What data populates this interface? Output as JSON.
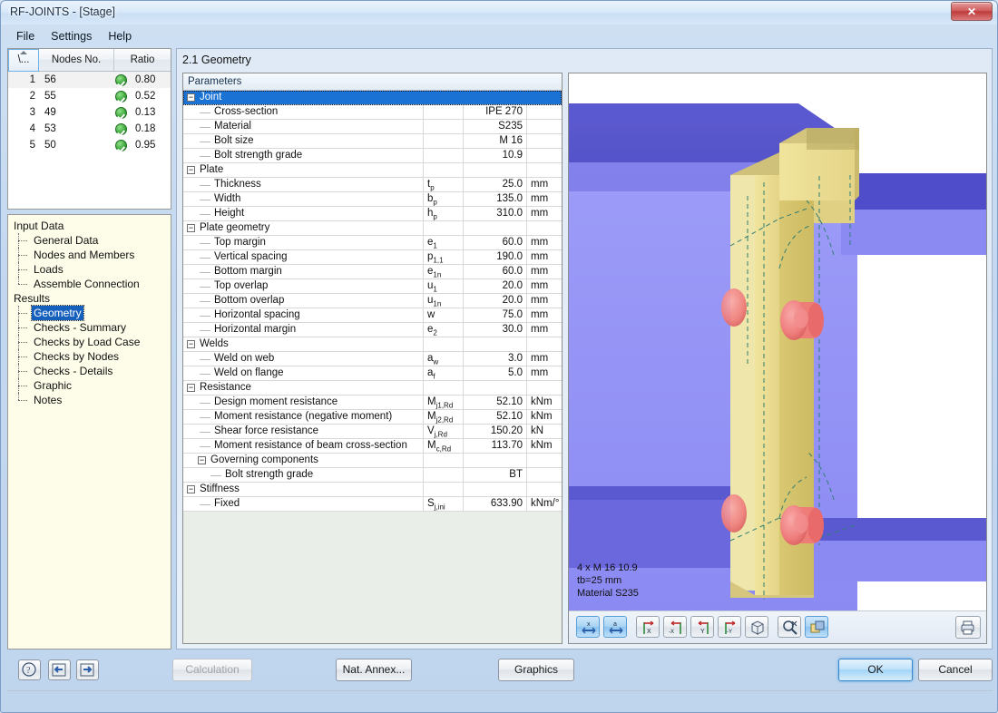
{
  "window": {
    "title": "RF-JOINTS - [Stage]",
    "close_label": "✕"
  },
  "menubar": {
    "items": [
      {
        "label": "File"
      },
      {
        "label": "Settings"
      },
      {
        "label": "Help"
      }
    ]
  },
  "node_table": {
    "headers": [
      "\\...",
      "Nodes No.",
      "Ratio"
    ],
    "rows": [
      {
        "index": "1",
        "node": "56",
        "ratio": "0.80",
        "status": "ok"
      },
      {
        "index": "2",
        "node": "55",
        "ratio": "0.52",
        "status": "ok"
      },
      {
        "index": "3",
        "node": "49",
        "ratio": "0.13",
        "status": "ok"
      },
      {
        "index": "4",
        "node": "53",
        "ratio": "0.18",
        "status": "ok"
      },
      {
        "index": "5",
        "node": "50",
        "ratio": "0.95",
        "status": "ok"
      }
    ]
  },
  "tree": {
    "groups": [
      {
        "label": "Input Data",
        "items": [
          {
            "label": "General Data",
            "selected": false
          },
          {
            "label": "Nodes and Members",
            "selected": false
          },
          {
            "label": "Loads",
            "selected": false
          },
          {
            "label": "Assemble Connection",
            "selected": false
          }
        ]
      },
      {
        "label": "Results",
        "items": [
          {
            "label": "Geometry",
            "selected": true
          },
          {
            "label": "Checks - Summary",
            "selected": false
          },
          {
            "label": "Checks by Load Case",
            "selected": false
          },
          {
            "label": "Checks by Nodes",
            "selected": false
          },
          {
            "label": "Checks - Details",
            "selected": false
          },
          {
            "label": "Graphic",
            "selected": false
          },
          {
            "label": "Notes",
            "selected": false
          }
        ]
      }
    ]
  },
  "main": {
    "section_title": "2.1 Geometry",
    "parameters_header": "Parameters",
    "rows": [
      {
        "kind": "group",
        "depth": 0,
        "label": "Joint",
        "symbol": "",
        "value": "",
        "unit": "",
        "selected": true,
        "expanded": true
      },
      {
        "kind": "item",
        "depth": 1,
        "label": "Cross-section",
        "symbol": "",
        "value": "IPE 270",
        "unit": ""
      },
      {
        "kind": "item",
        "depth": 1,
        "label": "Material",
        "symbol": "",
        "value": "S235",
        "unit": ""
      },
      {
        "kind": "item",
        "depth": 1,
        "label": "Bolt size",
        "symbol": "",
        "value": "M 16",
        "unit": ""
      },
      {
        "kind": "item",
        "depth": 1,
        "label": "Bolt strength grade",
        "symbol": "",
        "value": "10.9",
        "unit": ""
      },
      {
        "kind": "group",
        "depth": 0,
        "label": "Plate",
        "symbol": "",
        "value": "",
        "unit": "",
        "expanded": true
      },
      {
        "kind": "item",
        "depth": 1,
        "label": "Thickness",
        "symbol": "t",
        "sub": "p",
        "value": "25.0",
        "unit": "mm"
      },
      {
        "kind": "item",
        "depth": 1,
        "label": "Width",
        "symbol": "b",
        "sub": "p",
        "value": "135.0",
        "unit": "mm"
      },
      {
        "kind": "item",
        "depth": 1,
        "label": "Height",
        "symbol": "h",
        "sub": "p",
        "value": "310.0",
        "unit": "mm"
      },
      {
        "kind": "group",
        "depth": 0,
        "label": "Plate geometry",
        "symbol": "",
        "value": "",
        "unit": "",
        "expanded": true
      },
      {
        "kind": "item",
        "depth": 1,
        "label": "Top margin",
        "symbol": "e",
        "sub": "1",
        "value": "60.0",
        "unit": "mm"
      },
      {
        "kind": "item",
        "depth": 1,
        "label": "Vertical spacing",
        "symbol": "p",
        "sub": "1,1",
        "value": "190.0",
        "unit": "mm"
      },
      {
        "kind": "item",
        "depth": 1,
        "label": "Bottom margin",
        "symbol": "e",
        "sub": "1n",
        "value": "60.0",
        "unit": "mm"
      },
      {
        "kind": "item",
        "depth": 1,
        "label": "Top overlap",
        "symbol": "u",
        "sub": "1",
        "value": "20.0",
        "unit": "mm"
      },
      {
        "kind": "item",
        "depth": 1,
        "label": "Bottom overlap",
        "symbol": "u",
        "sub": "1n",
        "value": "20.0",
        "unit": "mm"
      },
      {
        "kind": "item",
        "depth": 1,
        "label": "Horizontal spacing",
        "symbol": "w",
        "sub": "",
        "value": "75.0",
        "unit": "mm"
      },
      {
        "kind": "item",
        "depth": 1,
        "label": "Horizontal margin",
        "symbol": "e",
        "sub": "2",
        "value": "30.0",
        "unit": "mm"
      },
      {
        "kind": "group",
        "depth": 0,
        "label": "Welds",
        "symbol": "",
        "value": "",
        "unit": "",
        "expanded": true
      },
      {
        "kind": "item",
        "depth": 1,
        "label": "Weld on web",
        "symbol": "a",
        "sub": "w",
        "value": "3.0",
        "unit": "mm"
      },
      {
        "kind": "item",
        "depth": 1,
        "label": "Weld on flange",
        "symbol": "a",
        "sub": "f",
        "value": "5.0",
        "unit": "mm"
      },
      {
        "kind": "group",
        "depth": 0,
        "label": "Resistance",
        "symbol": "",
        "value": "",
        "unit": "",
        "expanded": true
      },
      {
        "kind": "item",
        "depth": 1,
        "label": "Design moment resistance",
        "symbol": "M",
        "sub": "j1,Rd",
        "value": "52.10",
        "unit": "kNm"
      },
      {
        "kind": "item",
        "depth": 1,
        "label": "Moment resistance (negative moment)",
        "symbol": "M",
        "sub": "j2,Rd",
        "value": "52.10",
        "unit": "kNm"
      },
      {
        "kind": "item",
        "depth": 1,
        "label": "Shear force resistance",
        "symbol": "V",
        "sub": "j,Rd",
        "value": "150.20",
        "unit": "kN"
      },
      {
        "kind": "item",
        "depth": 1,
        "label": "Moment resistance of beam cross-section",
        "symbol": "M",
        "sub": "c,Rd",
        "value": "113.70",
        "unit": "kNm"
      },
      {
        "kind": "group",
        "depth": 1,
        "label": "Governing components",
        "symbol": "",
        "value": "",
        "unit": "",
        "expanded": true
      },
      {
        "kind": "item",
        "depth": 2,
        "label": "Bolt strength grade",
        "symbol": "",
        "value": "BT",
        "unit": ""
      },
      {
        "kind": "group",
        "depth": 0,
        "label": "Stiffness",
        "symbol": "",
        "value": "",
        "unit": "",
        "expanded": true
      },
      {
        "kind": "item",
        "depth": 1,
        "label": "Fixed",
        "symbol": "S",
        "sub": "j,ini",
        "value": "633.90",
        "unit": "kNm/°"
      }
    ]
  },
  "graphics": {
    "annotation": [
      "4 x M 16 10.9",
      "tb=25 mm",
      "Material S235"
    ],
    "toolbar": [
      {
        "name": "view-x-icon",
        "active": true
      },
      {
        "name": "view-a-icon",
        "active": true
      },
      {
        "name": "view-axis-x-icon",
        "active": false
      },
      {
        "name": "view-axis-minus-x-icon",
        "active": false
      },
      {
        "name": "view-axis-y-icon",
        "active": false
      },
      {
        "name": "view-axis-minus-y-icon",
        "active": false
      },
      {
        "name": "isometric-view-icon",
        "active": false
      },
      {
        "name": "zoom-reset-icon",
        "active": false
      },
      {
        "name": "render-mode-icon",
        "active": true
      }
    ],
    "print_icon": "printer-icon",
    "colors": {
      "beam": "#8f8ef5",
      "beam_dark": "#4a49c4",
      "plate": "#efe08a",
      "plate_dark": "#c9b95f",
      "bolt": "#f08080",
      "hidden_line": "#2f7d72"
    }
  },
  "bottombar": {
    "help_icon": "help-icon",
    "prev_icon": "previous-icon",
    "next_icon": "next-icon",
    "calculation_label": "Calculation",
    "nat_annex_label": "Nat. Annex...",
    "graphics_label": "Graphics",
    "ok_label": "OK",
    "cancel_label": "Cancel"
  }
}
